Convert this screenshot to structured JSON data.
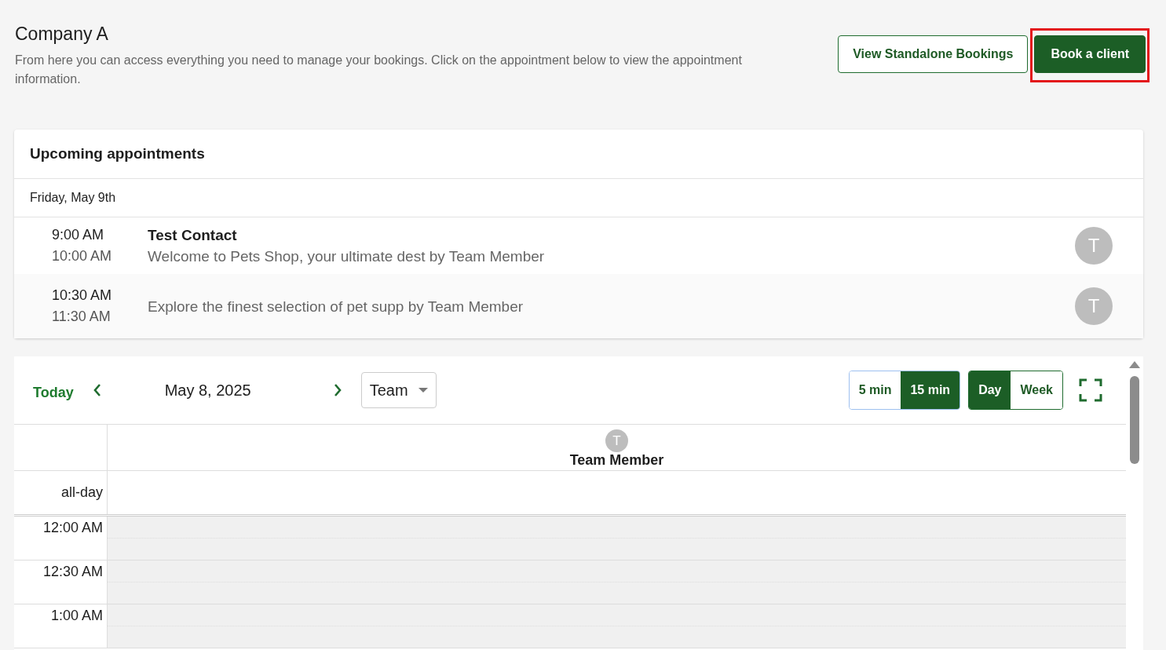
{
  "header": {
    "title": "Company A",
    "description": "From here you can access everything you need to manage your bookings. Click on the appointment below to view the appointment information.",
    "buttons": [
      {
        "label": "View Standalone Bookings",
        "kind": "outline",
        "highlighted": false
      },
      {
        "label": "Book a client",
        "kind": "primary",
        "highlighted": true
      }
    ]
  },
  "upcoming": {
    "title": "Upcoming appointments",
    "date": "Friday, May 9th",
    "appointments": [
      {
        "start": "9:00 AM",
        "end": "10:00 AM",
        "title": "Test Contact",
        "description": "Welcome to Pets Shop, your ultimate dest by Team Member",
        "avatar": "T"
      },
      {
        "start": "10:30 AM",
        "end": "11:30 AM",
        "description": "Explore the finest selection of pet supp by Team Member",
        "avatar": "T"
      }
    ]
  },
  "calendar": {
    "today": "Today",
    "date": "May 8, 2025",
    "view_select": {
      "value": "Team"
    },
    "intervals": [
      {
        "label": "5 min",
        "selected": false
      },
      {
        "label": "15 min",
        "selected": true
      }
    ],
    "views": [
      {
        "label": "Day",
        "selected": true
      },
      {
        "label": "Week",
        "selected": false
      }
    ],
    "resource": {
      "avatar": "T",
      "name": "Team Member"
    },
    "all_day": "all-day",
    "times": [
      "12:00 AM",
      "12:30 AM",
      "1:00 AM"
    ]
  }
}
